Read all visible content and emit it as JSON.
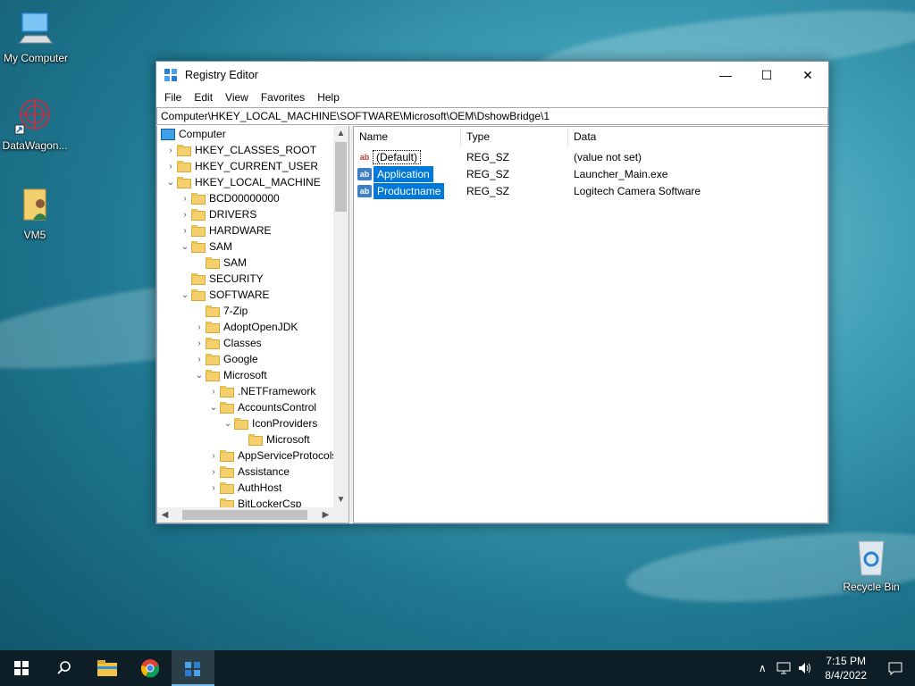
{
  "desktop": {
    "icons": [
      {
        "label": "My Computer"
      },
      {
        "label": "DataWagon..."
      },
      {
        "label": "VM5"
      },
      {
        "label": "Recycle Bin"
      }
    ]
  },
  "window": {
    "title": "Registry Editor",
    "controls": {
      "minimize": "—",
      "maximize": "☐",
      "close": "✕"
    },
    "menu": [
      "File",
      "Edit",
      "View",
      "Favorites",
      "Help"
    ],
    "address": "Computer\\HKEY_LOCAL_MACHINE\\SOFTWARE\\Microsoft\\OEM\\DshowBridge\\1",
    "tree": [
      {
        "label": "Computer",
        "level": 0,
        "expander": "",
        "type": "computer"
      },
      {
        "label": "HKEY_CLASSES_ROOT",
        "level": 1,
        "expander": "›"
      },
      {
        "label": "HKEY_CURRENT_USER",
        "level": 1,
        "expander": "›"
      },
      {
        "label": "HKEY_LOCAL_MACHINE",
        "level": 1,
        "expander": "⌄"
      },
      {
        "label": "BCD00000000",
        "level": 2,
        "expander": "›"
      },
      {
        "label": "DRIVERS",
        "level": 2,
        "expander": "›"
      },
      {
        "label": "HARDWARE",
        "level": 2,
        "expander": "›"
      },
      {
        "label": "SAM",
        "level": 2,
        "expander": "⌄"
      },
      {
        "label": "SAM",
        "level": 3,
        "expander": ""
      },
      {
        "label": "SECURITY",
        "level": 2,
        "expander": ""
      },
      {
        "label": "SOFTWARE",
        "level": 2,
        "expander": "⌄"
      },
      {
        "label": "7-Zip",
        "level": 3,
        "expander": ""
      },
      {
        "label": "AdoptOpenJDK",
        "level": 3,
        "expander": "›"
      },
      {
        "label": "Classes",
        "level": 3,
        "expander": "›"
      },
      {
        "label": "Google",
        "level": 3,
        "expander": "›"
      },
      {
        "label": "Microsoft",
        "level": 3,
        "expander": "⌄"
      },
      {
        "label": ".NETFramework",
        "level": 4,
        "expander": "›"
      },
      {
        "label": "AccountsControl",
        "level": 4,
        "expander": "⌄"
      },
      {
        "label": "IconProviders",
        "level": 5,
        "expander": "⌄"
      },
      {
        "label": "Microsoft",
        "level": 6,
        "expander": ""
      },
      {
        "label": "AppServiceProtocols",
        "level": 4,
        "expander": "›"
      },
      {
        "label": "Assistance",
        "level": 4,
        "expander": "›"
      },
      {
        "label": "AuthHost",
        "level": 4,
        "expander": "›"
      },
      {
        "label": "BitLockerCsp",
        "level": 4,
        "expander": ""
      }
    ],
    "columns": {
      "name": "Name",
      "type": "Type",
      "data": "Data"
    },
    "values": [
      {
        "name": "(Default)",
        "type": "REG_SZ",
        "data": "(value not set)",
        "icon": "ab",
        "selected": false,
        "focused": true
      },
      {
        "name": "Application",
        "type": "REG_SZ",
        "data": "Launcher_Main.exe",
        "icon": "ab",
        "selected": true,
        "focused": false
      },
      {
        "name": "Productname",
        "type": "REG_SZ",
        "data": "Logitech Camera Software",
        "icon": "ab",
        "selected": true,
        "focused": false
      }
    ]
  },
  "taskbar": {
    "time": "7:15 PM",
    "date": "8/4/2022"
  }
}
